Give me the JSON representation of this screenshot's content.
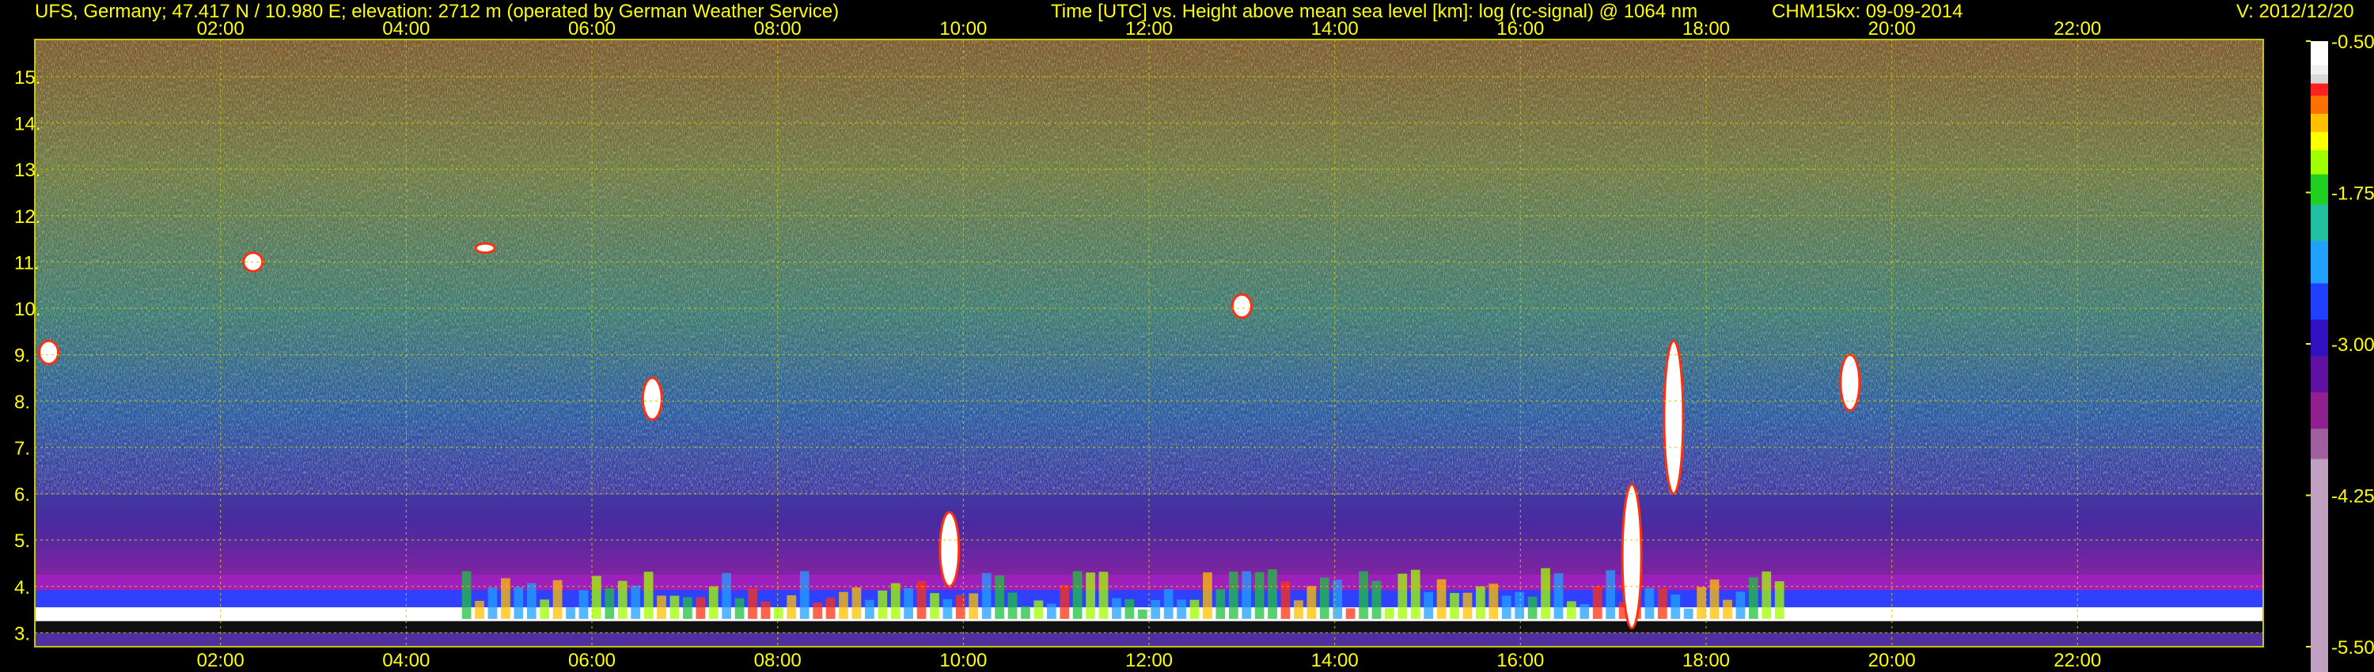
{
  "header": {
    "station": "UFS, Germany; 47.417 N / 10.980 E; elevation: 2712 m  (operated by German Weather Service)",
    "plot_desc": "Time [UTC] vs. Height above mean sea level [km]: log (rc-signal) @ 1064 nm",
    "instrument_date": "CHM15kx: 09-09-2014",
    "version": "V: 2012/12/20"
  },
  "colors": {
    "text": "#ffff00",
    "grid": "#c8c800",
    "background": "#000000",
    "colormap": [
      "#ffffff",
      "#f0f0f0",
      "#d8d8d8",
      "#ff2020",
      "#ff7000",
      "#ffc000",
      "#ffff00",
      "#a0ff00",
      "#20d020",
      "#20c0a0",
      "#20a0ff",
      "#2040ff",
      "#3010c0",
      "#6010a0",
      "#902090",
      "#a060a0",
      "#c0a0c0"
    ]
  },
  "chart_data": {
    "type": "heatmap",
    "title": "Time [UTC] vs. Height above mean sea level [km]: log (rc-signal) @ 1064 nm",
    "xlabel": "Time [UTC]",
    "ylabel": "Height above mean sea level [km]",
    "xlim": [
      0.0,
      24.0
    ],
    "ylim": [
      2.7,
      15.8
    ],
    "x_ticks": [
      "02:00",
      "04:00",
      "06:00",
      "08:00",
      "10:00",
      "12:00",
      "14:00",
      "16:00",
      "18:00",
      "20:00",
      "22:00"
    ],
    "x_tick_values": [
      2,
      4,
      6,
      8,
      10,
      12,
      14,
      16,
      18,
      20,
      22
    ],
    "y_ticks": [
      "3.",
      "4.",
      "5.",
      "6.",
      "7.",
      "8.",
      "9.",
      "10.",
      "11.",
      "12.",
      "13.",
      "14.",
      "15."
    ],
    "y_tick_values": [
      3,
      4,
      5,
      6,
      7,
      8,
      9,
      10,
      11,
      12,
      13,
      14,
      15
    ],
    "grid": true,
    "colorbar": {
      "labels": [
        "-0.50",
        "-1.75",
        "-3.00",
        "-4.25",
        "-5.50"
      ],
      "values": [
        -0.5,
        -1.75,
        -3.0,
        -4.25,
        -5.5
      ]
    },
    "boundary_layer_top_km": 3.95,
    "cloud_features": [
      {
        "time_h": 0.15,
        "base_km": 8.8,
        "top_km": 9.3
      },
      {
        "time_h": 2.35,
        "base_km": 10.8,
        "top_km": 11.2
      },
      {
        "time_h": 4.85,
        "base_km": 11.2,
        "top_km": 11.4
      },
      {
        "time_h": 6.65,
        "base_km": 7.6,
        "top_km": 8.5
      },
      {
        "time_h": 9.85,
        "base_km": 4.0,
        "top_km": 5.6
      },
      {
        "time_h": 13.0,
        "base_km": 9.8,
        "top_km": 10.3
      },
      {
        "time_h": 17.2,
        "base_km": 3.1,
        "top_km": 6.2
      },
      {
        "time_h": 17.65,
        "base_km": 6.0,
        "top_km": 9.3
      },
      {
        "time_h": 19.55,
        "base_km": 7.8,
        "top_km": 9.0
      }
    ]
  }
}
